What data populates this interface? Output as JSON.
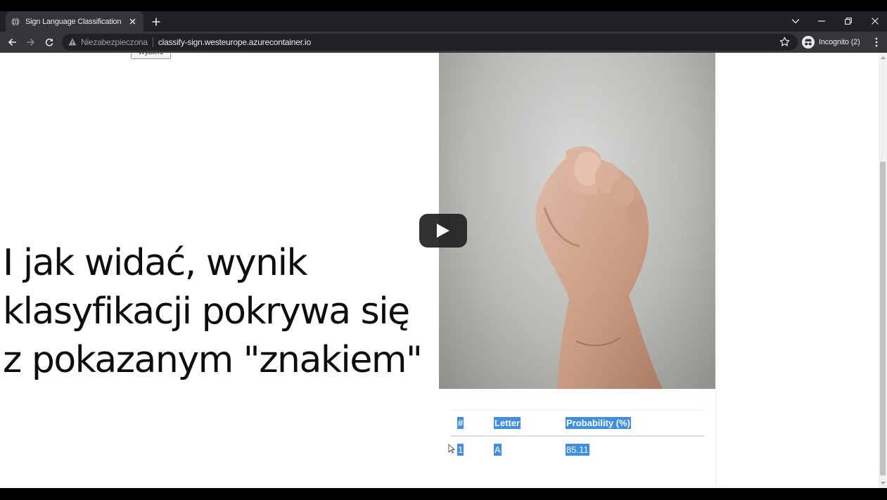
{
  "browser": {
    "tab_title": "Sign Language Classification",
    "not_secure_label": "Niezabezpieczona",
    "url": "classify-sign.westeurope.azurecontainer.io",
    "profile_label": "Incognito (2)"
  },
  "page": {
    "cut_button_label": "Wybierz",
    "caption_lines": [
      "I jak widać, wynik",
      "klasyfikacji pokrywa się",
      "z pokazanym \"znakiem\""
    ],
    "results": {
      "headers": [
        "#",
        "Letter",
        "Probability (%)"
      ],
      "rows": [
        [
          "1",
          "A",
          "85.11"
        ]
      ]
    }
  },
  "colors": {
    "selection_highlight": "#3c8ee9",
    "chrome_dark": "#202124",
    "chrome_toolbar": "#35363a"
  },
  "icons": [
    "globe-icon",
    "close-icon",
    "plus-icon",
    "chevron-down-icon",
    "minimize-icon",
    "restore-icon",
    "back-icon",
    "forward-icon",
    "reload-icon",
    "warning-icon",
    "star-icon",
    "incognito-icon",
    "kebab-menu-icon",
    "play-icon",
    "cursor-icon"
  ]
}
